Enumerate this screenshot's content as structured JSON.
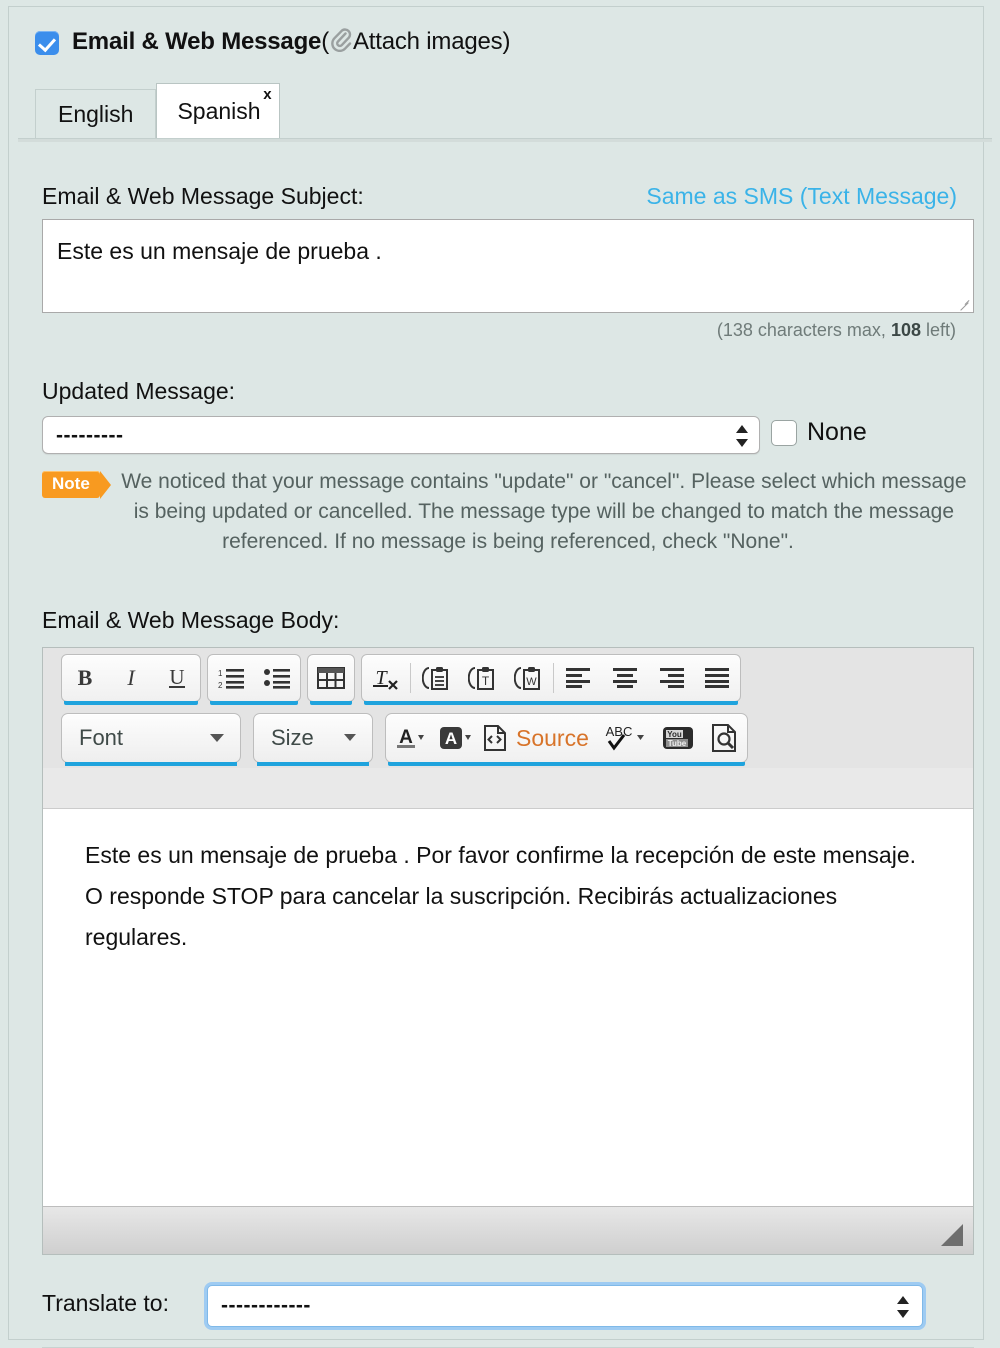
{
  "header": {
    "checkbox_checked": true,
    "title": "Email & Web Message",
    "paren_open": "(",
    "attach_label": "Attach images",
    "paren_close": ")",
    "clip_icon": "paperclip-icon"
  },
  "tabs": [
    {
      "label": "English",
      "active": false
    },
    {
      "label": "Spanish",
      "active": true,
      "close": "x"
    }
  ],
  "subject": {
    "label": "Email & Web Message Subject:",
    "same_as_sms": "Same as SMS (Text Message)",
    "value": "Este es un mensaje de prueba .",
    "count_prefix": "(138 characters max, ",
    "count_left": "108",
    "count_suffix": " left)"
  },
  "updated_message": {
    "label": "Updated Message:",
    "selected": "---------",
    "none_label": "None",
    "none_checked": false,
    "note_badge": "Note",
    "note_text": "We noticed that your message contains \"update\" or \"cancel\". Please select which message is being updated or cancelled. The message type will be changed to match the message referenced. If no message is being referenced, check \"None\"."
  },
  "body": {
    "label": "Email & Web Message Body:",
    "content": "Este es un mensaje de prueba . Por favor confirme la recepción de este mensaje. O responde STOP para cancelar la suscripción. Recibirás actualizaciones regulares."
  },
  "toolbar": {
    "row1": [
      {
        "name": "bold-icon",
        "label": "B"
      },
      {
        "name": "italic-icon",
        "label": "I"
      },
      {
        "name": "underline-icon",
        "label": "U"
      },
      {
        "name": "numbered-list-icon",
        "label": ""
      },
      {
        "name": "bulleted-list-icon",
        "label": ""
      },
      {
        "name": "table-icon",
        "label": ""
      },
      {
        "name": "remove-format-icon",
        "label": ""
      },
      {
        "name": "paste-icon",
        "label": ""
      },
      {
        "name": "paste-as-text-icon",
        "label": ""
      },
      {
        "name": "paste-from-word-icon",
        "label": ""
      },
      {
        "name": "align-left-icon",
        "label": ""
      },
      {
        "name": "align-center-icon",
        "label": ""
      },
      {
        "name": "align-right-icon",
        "label": ""
      },
      {
        "name": "align-justify-icon",
        "label": ""
      }
    ],
    "font_label": "Font",
    "size_label": "Size",
    "text_color_icon": "text-color-icon",
    "bg_color_icon": "background-color-icon",
    "source_label": "Source",
    "source_icon": "source-code-icon",
    "spellcheck_icon": "spellcheck-icon",
    "spellcheck_label": "ABC",
    "youtube_icon": "youtube-icon",
    "youtube_line1": "You",
    "youtube_line2": "Tube",
    "preview_icon": "preview-icon"
  },
  "translate": {
    "label": "Translate to:",
    "selected": "------------"
  },
  "colors": {
    "background": "#dde7e5",
    "link": "#3ab3e8",
    "accent_bar": "#1fa3dd",
    "note_badge": "#f89a20",
    "checkbox": "#3b8eec",
    "source_text": "#d8742a"
  }
}
